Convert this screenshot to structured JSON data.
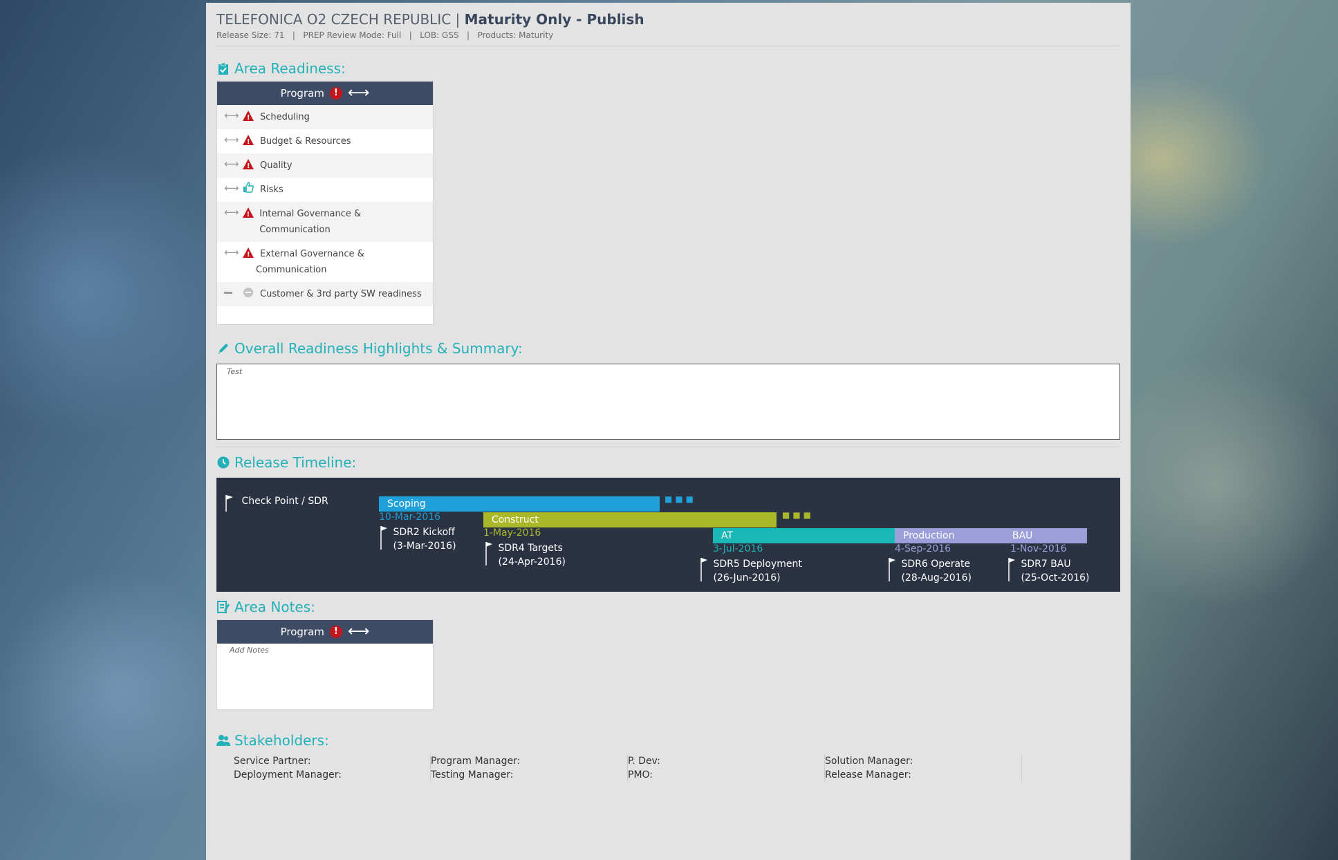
{
  "header": {
    "client": "TELEFONICA O2 CZECH REPUBLIC |",
    "release": "Maturity Only - Publish",
    "meta": "Release Size: 71   |   PREP Review Mode: Full   |   LOB: GSS   |   Products: Maturity"
  },
  "area_readiness": {
    "title": "Area Readiness:",
    "panel_title": "Program",
    "rows": [
      {
        "label": "Scheduling",
        "status": "warning"
      },
      {
        "label": "Budget & Resources",
        "status": "warning"
      },
      {
        "label": "Quality",
        "status": "warning"
      },
      {
        "label": "Risks",
        "status": "thumbs-up"
      },
      {
        "label": "Internal Governance & Communication",
        "status": "warning"
      },
      {
        "label": "External Governance &",
        "label2": "Communication",
        "status": "warning"
      },
      {
        "label": "Customer & 3rd party SW readiness",
        "status": "none"
      }
    ]
  },
  "summary": {
    "title": "Overall Readiness Highlights & Summary:",
    "text": "Test"
  },
  "timeline": {
    "title": "Release Timeline:",
    "legend": "Check Point / SDR",
    "phases": [
      {
        "label": "Scoping",
        "date": "10-Mar-2016",
        "color": "#1fa0d8"
      },
      {
        "label": "Construct",
        "date": "1-May-2016",
        "color": "#a8b828"
      },
      {
        "label": "AT",
        "date": "3-Jul-2016",
        "color": "#1ab7b7"
      },
      {
        "label": "Production",
        "date": "4-Sep-2016",
        "color": "#9b9ed8"
      },
      {
        "label": "BAU",
        "date": "1-Nov-2016",
        "color": "#9b9ed8"
      }
    ],
    "checkpoints": [
      {
        "name": "SDR2 Kickoff",
        "date": "(3-Mar-2016)"
      },
      {
        "name": "SDR4 Targets",
        "date": "(24-Apr-2016)"
      },
      {
        "name": "SDR5 Deployment",
        "date": "(26-Jun-2016)"
      },
      {
        "name": "SDR6 Operate",
        "date": "(28-Aug-2016)"
      },
      {
        "name": "SDR7 BAU",
        "date": "(25-Oct-2016)"
      }
    ]
  },
  "area_notes": {
    "title": "Area Notes:",
    "panel_title": "Program",
    "placeholder": "Add Notes"
  },
  "stakeholders": {
    "title": "Stakeholders:",
    "columns": [
      [
        "Service Partner:",
        "Deployment Manager:"
      ],
      [
        "Program Manager:",
        "Testing Manager:"
      ],
      [
        "P. Dev:",
        "PMO:"
      ],
      [
        "Solution Manager:",
        "Release Manager:"
      ]
    ]
  }
}
